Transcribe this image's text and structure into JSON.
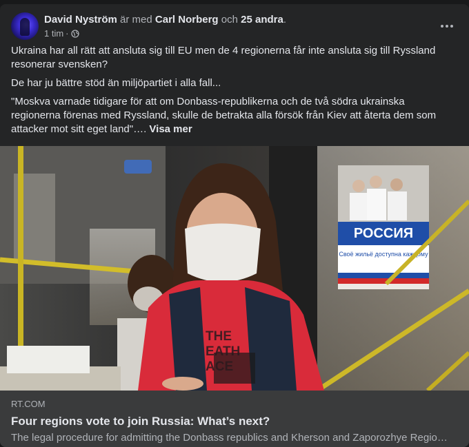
{
  "post": {
    "author": "David Nyström",
    "with_text": "är med",
    "tagged": "Carl Norberg",
    "and_text": "och",
    "others": "25 andra",
    "period": ".",
    "time": "1 tim",
    "dot": "·",
    "privacy_icon": "public-globe-icon",
    "more_icon": "more-options-icon",
    "paragraphs": [
      "Ukraina har all rätt att ansluta sig till EU men de 4 regionerna får inte ansluta sig till Ryssland resonerar svensken?",
      "De har ju bättre stöd än miljöpartiet i alla fall...",
      "\"Moskva varnade tidigare för att om Donbass-republikerna och de två södra ukrainska regionerna förenas med Ryssland, skulle de betrakta alla försök från Kiev att återta dem som attacker mot sitt eget land\"…."
    ],
    "see_more": "Visa mer"
  },
  "image": {
    "poster_title": "РОССИЯ",
    "poster_sub": "Своё жильё доступна каждому",
    "shirt_text": "THE\nEATH\nACE"
  },
  "link": {
    "domain": "RT.COM",
    "title": "Four regions vote to join Russia: What’s next?",
    "description": "The legal procedure for admitting the Donbass republics and Kherson and Zaporozhye Regio…"
  }
}
